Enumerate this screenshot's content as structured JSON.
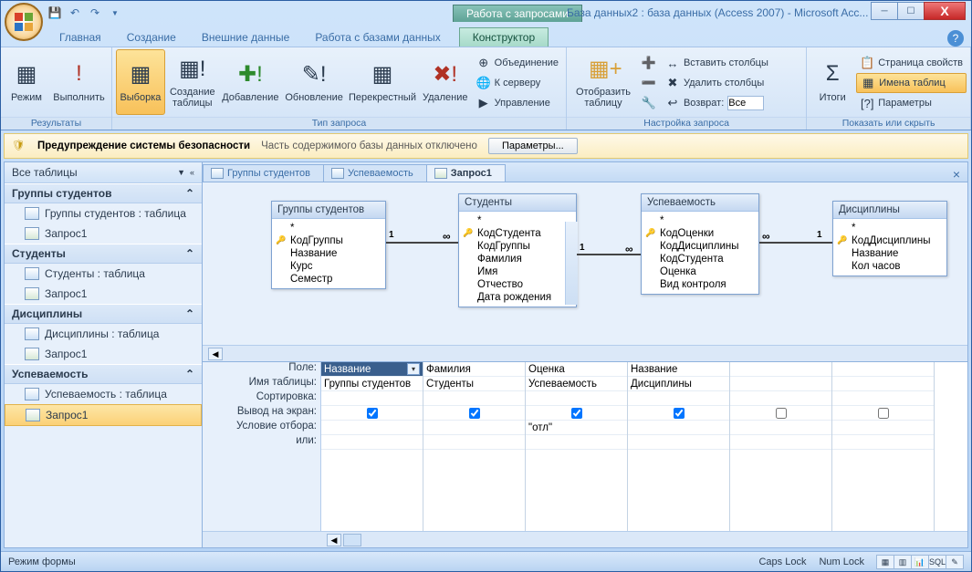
{
  "window": {
    "context_group": "Работа с запросами",
    "file_title": "База данных2 : база данных (Access 2007) - Microsoft Acc..."
  },
  "tabs": {
    "t1": "Главная",
    "t2": "Создание",
    "t3": "Внешние данные",
    "t4": "Работа с базами данных",
    "t5": "Конструктор"
  },
  "ribbon": {
    "g1": {
      "label": "Результаты",
      "b1": "Режим",
      "b2": "Выполнить"
    },
    "g2": {
      "label": "Тип запроса",
      "b1": "Выборка",
      "b2": "Создание\nтаблицы",
      "b3": "Добавление",
      "b4": "Обновление",
      "b5": "Перекрестный",
      "b6": "Удаление",
      "s1": "Объединение",
      "s2": "К серверу",
      "s3": "Управление"
    },
    "g3": {
      "label": "Настройка запроса",
      "b1": "Отобразить\nтаблицу",
      "s1": "Вставить столбцы",
      "s2": "Удалить столбцы",
      "s3": "Возврат:",
      "s3v": "Все"
    },
    "g4": {
      "label": "Показать или скрыть",
      "b1": "Итоги",
      "s1": "Страница свойств",
      "s2": "Имена таблиц",
      "s3": "Параметры"
    }
  },
  "security": {
    "title": "Предупреждение системы безопасности",
    "msg": "Часть содержимого базы данных отключено",
    "btn": "Параметры..."
  },
  "nav": {
    "header": "Все таблицы",
    "g1": {
      "title": "Группы студентов",
      "i1": "Группы студентов : таблица",
      "i2": "Запрос1"
    },
    "g2": {
      "title": "Студенты",
      "i1": "Студенты : таблица",
      "i2": "Запрос1"
    },
    "g3": {
      "title": "Дисциплины",
      "i1": "Дисциплины : таблица",
      "i2": "Запрос1"
    },
    "g4": {
      "title": "Успеваемость",
      "i1": "Успеваемость : таблица",
      "i2": "Запрос1"
    }
  },
  "doctabs": {
    "t1": "Группы студентов",
    "t2": "Успеваемость",
    "t3": "Запрос1"
  },
  "tables": {
    "t1": {
      "title": "Группы студентов",
      "star": "*",
      "f1": "КодГруппы",
      "f2": "Название",
      "f3": "Курс",
      "f4": "Семестр"
    },
    "t2": {
      "title": "Студенты",
      "star": "*",
      "f1": "КодСтудента",
      "f2": "КодГруппы",
      "f3": "Фамилия",
      "f4": "Имя",
      "f5": "Отчество",
      "f6": "Дата рождения"
    },
    "t3": {
      "title": "Успеваемость",
      "star": "*",
      "f1": "КодОценки",
      "f2": "КодДисциплины",
      "f3": "КодСтудента",
      "f4": "Оценка",
      "f5": "Вид контроля"
    },
    "t4": {
      "title": "Дисциплины",
      "star": "*",
      "f1": "КодДисциплины",
      "f2": "Название",
      "f3": "Кол часов"
    }
  },
  "rel": {
    "one": "1",
    "inf": "∞"
  },
  "grid": {
    "r1": "Поле:",
    "r2": "Имя таблицы:",
    "r3": "Сортировка:",
    "r4": "Вывод на экран:",
    "r5": "Условие отбора:",
    "r6": "или:",
    "c1": {
      "field": "Название",
      "table": "Группы студентов"
    },
    "c2": {
      "field": "Фамилия",
      "table": "Студенты"
    },
    "c3": {
      "field": "Оценка",
      "table": "Успеваемость",
      "crit": "\"отл\""
    },
    "c4": {
      "field": "Название",
      "table": "Дисциплины"
    }
  },
  "status": {
    "left": "Режим формы",
    "caps": "Caps Lock",
    "num": "Num Lock"
  }
}
